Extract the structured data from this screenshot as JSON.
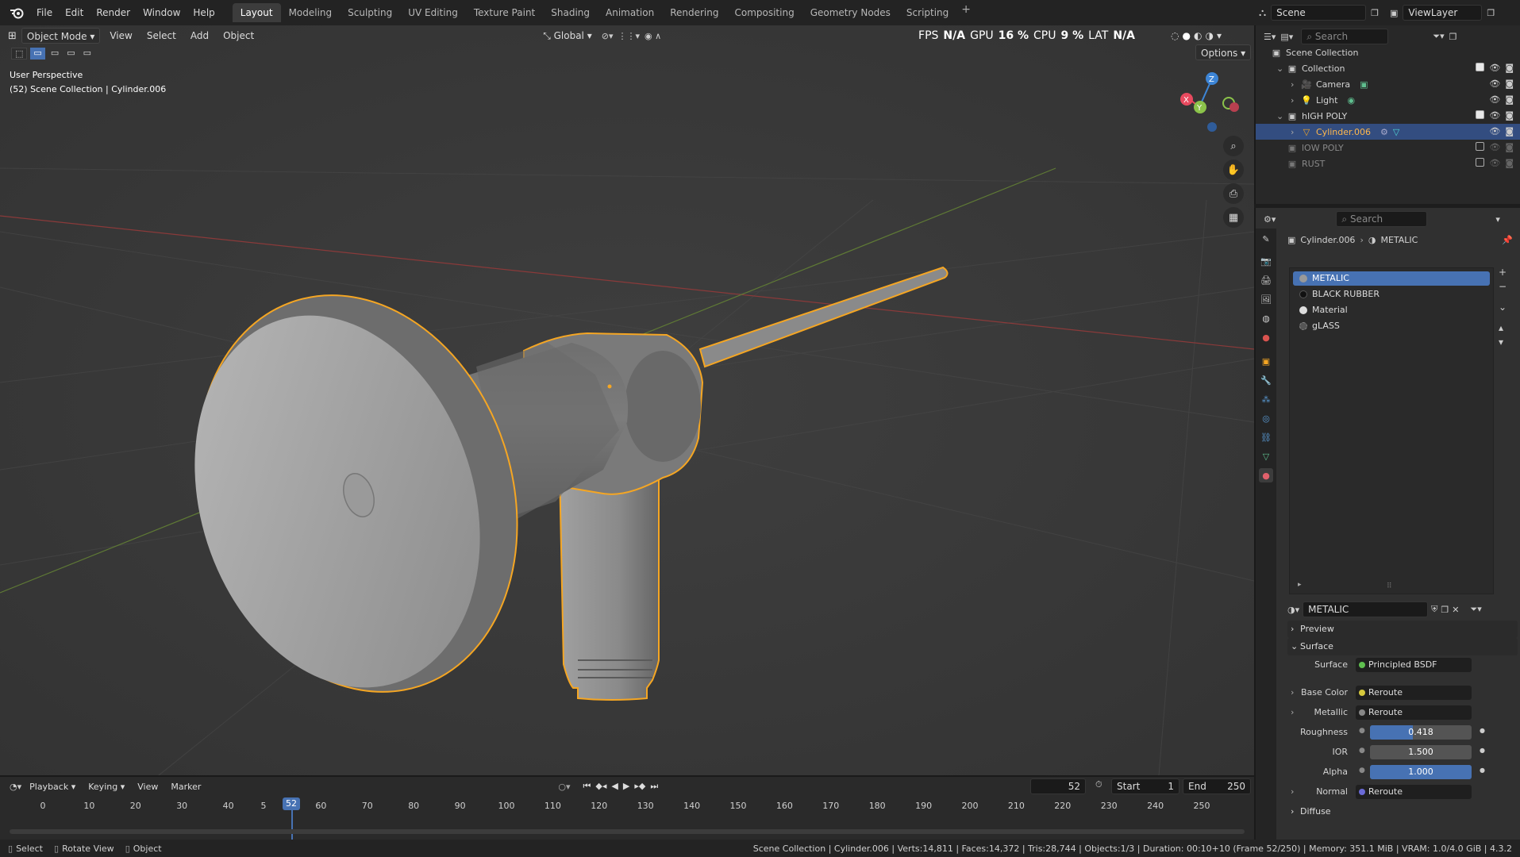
{
  "menus": [
    "File",
    "Edit",
    "Render",
    "Window",
    "Help"
  ],
  "workspaces": [
    "Layout",
    "Modeling",
    "Sculpting",
    "UV Editing",
    "Texture Paint",
    "Shading",
    "Animation",
    "Rendering",
    "Compositing",
    "Geometry Nodes",
    "Scripting"
  ],
  "active_workspace": "Layout",
  "scene_name": "Scene",
  "view_layer": "ViewLayer",
  "viewport": {
    "mode": "Object Mode",
    "menu": [
      "View",
      "Select",
      "Add",
      "Object"
    ],
    "orientation": "Global",
    "options": "Options",
    "perspective_label": "User Perspective",
    "collection_label": "(52) Scene Collection | Cylinder.006",
    "stats": {
      "fps_label": "FPS",
      "fps": "N/A",
      "gpu_label": "GPU",
      "gpu": "16 %",
      "cpu_label": "CPU",
      "cpu": "9 %",
      "lat_label": "LAT",
      "lat": "N/A"
    }
  },
  "outliner": {
    "search_placeholder": "Search",
    "items": [
      {
        "label": "Scene Collection"
      },
      {
        "label": "Collection"
      },
      {
        "label": "Camera"
      },
      {
        "label": "Light"
      },
      {
        "label": "hIGH POLY"
      },
      {
        "label": "Cylinder.006"
      },
      {
        "label": "lOW POLY"
      },
      {
        "label": "RUST"
      }
    ]
  },
  "properties": {
    "search_placeholder": "Search",
    "breadcrumb_object": "Cylinder.006",
    "breadcrumb_material": "METALIC",
    "materials": [
      "METALIC",
      "BLACK RUBBER",
      "Material",
      "gLASS"
    ],
    "active_material": "METALIC",
    "sections": {
      "preview": "Preview",
      "surface": "Surface",
      "diffuse": "Diffuse"
    },
    "fields": {
      "surface_label": "Surface",
      "surface_value": "Principled BSDF",
      "base_color_label": "Base Color",
      "base_color_value": "Reroute",
      "metallic_label": "Metallic",
      "metallic_value": "Reroute",
      "roughness_label": "Roughness",
      "roughness_value": "0.418",
      "ior_label": "IOR",
      "ior_value": "1.500",
      "alpha_label": "Alpha",
      "alpha_value": "1.000",
      "normal_label": "Normal",
      "normal_value": "Reroute"
    },
    "roughness_fraction": 0.418,
    "alpha_fraction": 1.0
  },
  "timeline": {
    "menu": [
      "Playback",
      "Keying",
      "View",
      "Marker"
    ],
    "current_frame": "52",
    "start_label": "Start",
    "start": "1",
    "end_label": "End",
    "end": "250",
    "ruler": [
      "0",
      "10",
      "20",
      "30",
      "40",
      "5",
      "60",
      "70",
      "80",
      "90",
      "100",
      "110",
      "120",
      "130",
      "140",
      "150",
      "160",
      "170",
      "180",
      "190",
      "200",
      "210",
      "220",
      "230",
      "240",
      "250"
    ]
  },
  "statusbar": {
    "select": "Select",
    "rotate": "Rotate View",
    "object": "Object",
    "info": "Scene Collection | Cylinder.006 | Verts:14,811 | Faces:14,372 | Tris:28,744 | Objects:1/3 | Duration: 00:10+10 (Frame 52/250) | Memory: 351.1 MiB | VRAM: 1.0/4.0 GiB | 4.3.2"
  },
  "colors": {
    "accent": "#4772b3",
    "selection_outline": "#f5a623",
    "x_axis": "#e84a5f",
    "y_axis": "#8bc34a",
    "z_axis": "#3d85d6"
  }
}
